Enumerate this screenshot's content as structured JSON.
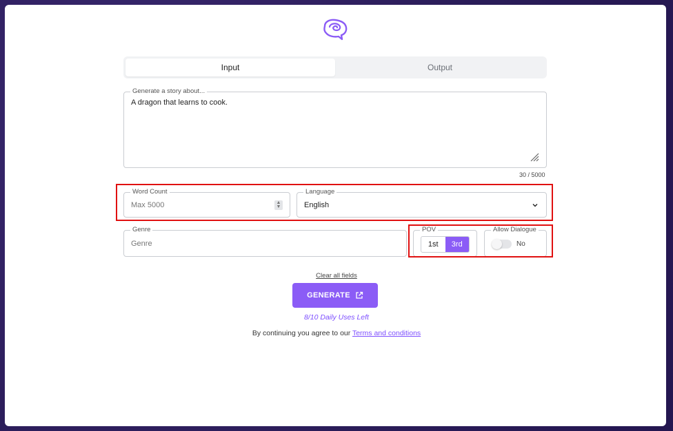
{
  "tabs": [
    {
      "label": "Input",
      "active": true
    },
    {
      "label": "Output",
      "active": false
    }
  ],
  "story": {
    "legend": "Generate a story about...",
    "value": "A dragon that learns to cook.",
    "counter": "30 / 5000"
  },
  "word_count": {
    "legend": "Word Count",
    "placeholder": "Max 5000"
  },
  "language": {
    "legend": "Language",
    "value": "English"
  },
  "genre": {
    "legend": "Genre",
    "placeholder": "Genre"
  },
  "pov": {
    "legend": "POV",
    "options": [
      "1st",
      "3rd"
    ],
    "selected": "3rd"
  },
  "dialogue": {
    "legend": "Allow Dialogue",
    "value": "No"
  },
  "actions": {
    "clear_label": "Clear all fields",
    "generate_label": "GENERATE",
    "uses_text": "8/10 Daily Uses Left",
    "terms_prefix": "By continuing you agree to our ",
    "terms_link": "Terms and conditions"
  },
  "colors": {
    "accent": "#8b5cf6",
    "highlight": "#e01010",
    "background": "#2d1f5e"
  }
}
